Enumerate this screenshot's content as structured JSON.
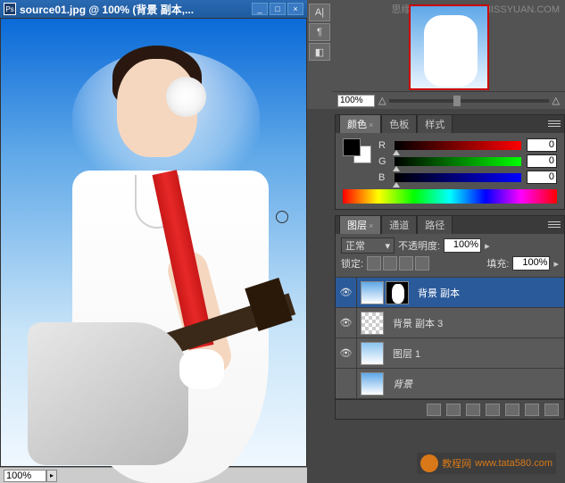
{
  "doc": {
    "title": "source01.jpg @ 100% (背景 副本,...",
    "zoom": "100%"
  },
  "nav": {
    "zoom": "100%",
    "watermark_line1": "思缘设计论坛",
    "watermark_line2": "WWW.MISSYUAN.COM"
  },
  "colorPanel": {
    "tabs": [
      "颜色",
      "色板",
      "样式"
    ],
    "channels": [
      {
        "label": "R",
        "value": "0"
      },
      {
        "label": "G",
        "value": "0"
      },
      {
        "label": "B",
        "value": "0"
      }
    ]
  },
  "layerPanel": {
    "tabs": [
      "图层",
      "通道",
      "路径"
    ],
    "blendMode": "正常",
    "opacityLabel": "不透明度:",
    "opacity": "100%",
    "lockLabel": "锁定:",
    "fillLabel": "填充:",
    "fill": "100%",
    "layers": [
      {
        "name": "背景 副本",
        "selected": true,
        "thumbs": [
          "photo",
          "mask"
        ],
        "visible": true
      },
      {
        "name": "背景 副本 3",
        "selected": false,
        "thumbs": [
          "checker"
        ],
        "visible": true
      },
      {
        "name": "图层 1",
        "selected": false,
        "thumbs": [
          "grad"
        ],
        "visible": true
      },
      {
        "name": "背景",
        "selected": false,
        "thumbs": [
          "photo"
        ],
        "visible": false,
        "italic": true
      }
    ]
  },
  "bottomWatermark": {
    "text1": "教程网",
    "text2": "www.tata580.com"
  }
}
